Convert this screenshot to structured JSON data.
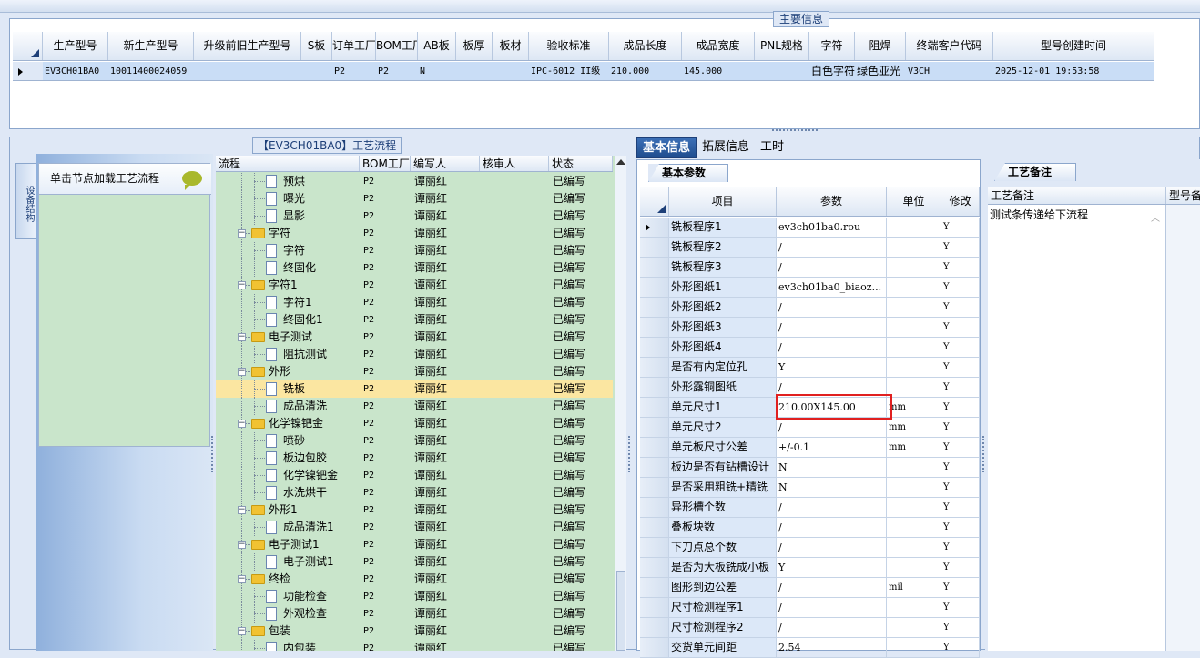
{
  "main_panel": {
    "title": "主要信息",
    "columns": [
      "生产型号",
      "新生产型号",
      "升级前旧生产型号",
      "S板",
      "订单工厂",
      "BOM工厂",
      "AB板",
      "板厚",
      "板材",
      "验收标准",
      "成品长度",
      "成品宽度",
      "PNL规格",
      "字符",
      "阻焊",
      "终端客户代码",
      "型号创建时间"
    ],
    "row": [
      "EV3CH01BA0",
      "10011400024059",
      "",
      "",
      "P2",
      "P2",
      "N",
      "",
      "",
      "IPC-6012 II级",
      "210.000",
      "145.000",
      "",
      "白色字符",
      "绿色亚光",
      "V3CH",
      "2025-12-01 19:53:58"
    ]
  },
  "process": {
    "title": "【EV3CH01BA0】工艺流程",
    "side_tab": "设备结构",
    "load_button": "单击节点加载工艺流程",
    "columns": [
      "流程",
      "BOM工厂",
      "编写人",
      "核审人",
      "状态"
    ],
    "rows": [
      {
        "name": "预烘",
        "level": 2,
        "type": "doc",
        "factory": "P2",
        "writer": "谭丽红",
        "reviewer": "",
        "status": "已编写"
      },
      {
        "name": "曝光",
        "level": 2,
        "type": "doc",
        "factory": "P2",
        "writer": "谭丽红",
        "reviewer": "",
        "status": "已编写"
      },
      {
        "name": "显影",
        "level": 2,
        "type": "doc",
        "factory": "P2",
        "writer": "谭丽红",
        "reviewer": "",
        "status": "已编写"
      },
      {
        "name": "字符",
        "level": 1,
        "type": "folder",
        "factory": "P2",
        "writer": "谭丽红",
        "reviewer": "",
        "status": "已编写"
      },
      {
        "name": "字符",
        "level": 2,
        "type": "doc",
        "factory": "P2",
        "writer": "谭丽红",
        "reviewer": "",
        "status": "已编写"
      },
      {
        "name": "终固化",
        "level": 2,
        "type": "doc",
        "factory": "P2",
        "writer": "谭丽红",
        "reviewer": "",
        "status": "已编写"
      },
      {
        "name": "字符1",
        "level": 1,
        "type": "folder",
        "factory": "P2",
        "writer": "谭丽红",
        "reviewer": "",
        "status": "已编写"
      },
      {
        "name": "字符1",
        "level": 2,
        "type": "doc",
        "factory": "P2",
        "writer": "谭丽红",
        "reviewer": "",
        "status": "已编写"
      },
      {
        "name": "终固化1",
        "level": 2,
        "type": "doc",
        "factory": "P2",
        "writer": "谭丽红",
        "reviewer": "",
        "status": "已编写"
      },
      {
        "name": "电子测试",
        "level": 1,
        "type": "folder",
        "factory": "P2",
        "writer": "谭丽红",
        "reviewer": "",
        "status": "已编写"
      },
      {
        "name": "阻抗测试",
        "level": 2,
        "type": "doc",
        "factory": "P2",
        "writer": "谭丽红",
        "reviewer": "",
        "status": "已编写"
      },
      {
        "name": "外形",
        "level": 1,
        "type": "folder",
        "factory": "P2",
        "writer": "谭丽红",
        "reviewer": "",
        "status": "已编写"
      },
      {
        "name": "铣板",
        "level": 2,
        "type": "doc",
        "factory": "P2",
        "writer": "谭丽红",
        "reviewer": "",
        "status": "已编写",
        "selected": true
      },
      {
        "name": "成品清洗",
        "level": 2,
        "type": "doc",
        "factory": "P2",
        "writer": "谭丽红",
        "reviewer": "",
        "status": "已编写"
      },
      {
        "name": "化学镍钯金",
        "level": 1,
        "type": "folder",
        "factory": "P2",
        "writer": "谭丽红",
        "reviewer": "",
        "status": "已编写"
      },
      {
        "name": "喷砂",
        "level": 2,
        "type": "doc",
        "factory": "P2",
        "writer": "谭丽红",
        "reviewer": "",
        "status": "已编写"
      },
      {
        "name": "板边包胶",
        "level": 2,
        "type": "doc",
        "factory": "P2",
        "writer": "谭丽红",
        "reviewer": "",
        "status": "已编写"
      },
      {
        "name": "化学镍钯金",
        "level": 2,
        "type": "doc",
        "factory": "P2",
        "writer": "谭丽红",
        "reviewer": "",
        "status": "已编写"
      },
      {
        "name": "水洗烘干",
        "level": 2,
        "type": "doc",
        "factory": "P2",
        "writer": "谭丽红",
        "reviewer": "",
        "status": "已编写"
      },
      {
        "name": "外形1",
        "level": 1,
        "type": "folder",
        "factory": "P2",
        "writer": "谭丽红",
        "reviewer": "",
        "status": "已编写"
      },
      {
        "name": "成品清洗1",
        "level": 2,
        "type": "doc",
        "factory": "P2",
        "writer": "谭丽红",
        "reviewer": "",
        "status": "已编写"
      },
      {
        "name": "电子测试1",
        "level": 1,
        "type": "folder",
        "factory": "P2",
        "writer": "谭丽红",
        "reviewer": "",
        "status": "已编写"
      },
      {
        "name": "电子测试1",
        "level": 2,
        "type": "doc",
        "factory": "P2",
        "writer": "谭丽红",
        "reviewer": "",
        "status": "已编写"
      },
      {
        "name": "终检",
        "level": 1,
        "type": "folder",
        "factory": "P2",
        "writer": "谭丽红",
        "reviewer": "",
        "status": "已编写"
      },
      {
        "name": "功能检查",
        "level": 2,
        "type": "doc",
        "factory": "P2",
        "writer": "谭丽红",
        "reviewer": "",
        "status": "已编写"
      },
      {
        "name": "外观检查",
        "level": 2,
        "type": "doc",
        "factory": "P2",
        "writer": "谭丽红",
        "reviewer": "",
        "status": "已编写"
      },
      {
        "name": "包装",
        "level": 1,
        "type": "folder",
        "factory": "P2",
        "writer": "谭丽红",
        "reviewer": "",
        "status": "已编写"
      },
      {
        "name": "内包装",
        "level": 2,
        "type": "doc",
        "factory": "P2",
        "writer": "谭丽红",
        "reviewer": "",
        "status": "已编写"
      }
    ]
  },
  "detail": {
    "tabs": [
      "基本信息",
      "拓展信息",
      "工时"
    ],
    "basic_tab": "基本参数",
    "columns": [
      "项目",
      "参数",
      "单位",
      "修改"
    ],
    "rows": [
      {
        "item": "铣板程序1",
        "param": "ev3ch01ba0.rou",
        "unit": "",
        "mod": "Y"
      },
      {
        "item": "铣板程序2",
        "param": "/",
        "unit": "",
        "mod": "Y"
      },
      {
        "item": "铣板程序3",
        "param": "/",
        "unit": "",
        "mod": "Y"
      },
      {
        "item": "外形图纸1",
        "param": "ev3ch01ba0_biaoz...",
        "unit": "",
        "mod": "Y"
      },
      {
        "item": "外形图纸2",
        "param": "/",
        "unit": "",
        "mod": "Y"
      },
      {
        "item": "外形图纸3",
        "param": "/",
        "unit": "",
        "mod": "Y"
      },
      {
        "item": "外形图纸4",
        "param": "/",
        "unit": "",
        "mod": "Y"
      },
      {
        "item": "是否有内定位孔",
        "param": "Y",
        "unit": "",
        "mod": "Y"
      },
      {
        "item": "外形露铜图纸",
        "param": "/",
        "unit": "",
        "mod": "Y"
      },
      {
        "item": "单元尺寸1",
        "param": "210.00X145.00",
        "unit": "mm",
        "mod": "Y"
      },
      {
        "item": "单元尺寸2",
        "param": "/",
        "unit": "mm",
        "mod": "Y"
      },
      {
        "item": "单元板尺寸公差",
        "param": "+/-0.1",
        "unit": "mm",
        "mod": "Y"
      },
      {
        "item": "板边是否有钻槽设计",
        "param": "N",
        "unit": "",
        "mod": "Y"
      },
      {
        "item": "是否采用粗铣+精铣",
        "param": "N",
        "unit": "",
        "mod": "Y"
      },
      {
        "item": "异形槽个数",
        "param": "/",
        "unit": "",
        "mod": "Y"
      },
      {
        "item": "叠板块数",
        "param": "/",
        "unit": "",
        "mod": "Y"
      },
      {
        "item": "下刀点总个数",
        "param": "/",
        "unit": "",
        "mod": "Y"
      },
      {
        "item": "是否为大板铣成小板",
        "param": "Y",
        "unit": "",
        "mod": "Y"
      },
      {
        "item": "图形到边公差",
        "param": "/",
        "unit": "mil",
        "mod": "Y"
      },
      {
        "item": "尺寸检测程序1",
        "param": "/",
        "unit": "",
        "mod": "Y"
      },
      {
        "item": "尺寸检测程序2",
        "param": "/",
        "unit": "",
        "mod": "Y"
      },
      {
        "item": "交货单元间距",
        "param": "2.54",
        "unit": "",
        "mod": "Y"
      }
    ]
  },
  "remark": {
    "tab": "工艺备注",
    "columns": [
      "工艺备注",
      "型号备"
    ],
    "text": "测试条传递给下流程"
  }
}
